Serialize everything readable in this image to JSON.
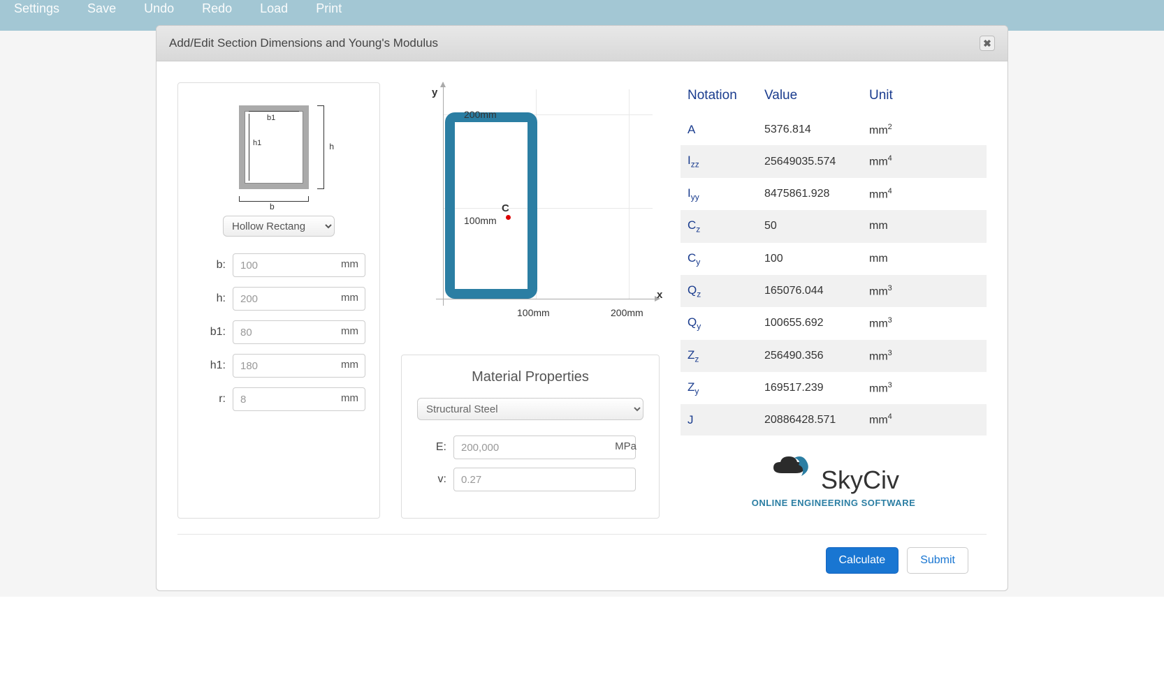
{
  "menu": {
    "settings": "Settings",
    "save": "Save",
    "undo": "Undo",
    "redo": "Redo",
    "load": "Load",
    "print": "Print"
  },
  "dialog": {
    "title": "Add/Edit Section Dimensions and Young's Modulus"
  },
  "shape_select": "Hollow Rectang",
  "diagram": {
    "b": "b",
    "h": "h",
    "b1": "b1",
    "h1": "h1"
  },
  "dims": {
    "b": {
      "label": "b:",
      "value": "100",
      "unit": "mm"
    },
    "h": {
      "label": "h:",
      "value": "200",
      "unit": "mm"
    },
    "b1": {
      "label": "b1:",
      "value": "80",
      "unit": "mm"
    },
    "h1": {
      "label": "h1:",
      "value": "180",
      "unit": "mm"
    },
    "r": {
      "label": "r:",
      "value": "8",
      "unit": "mm"
    }
  },
  "graph": {
    "ylabel": "y",
    "xlabel": "x",
    "centroid": "C",
    "x_tick_1": "100mm",
    "x_tick_2": "200mm",
    "y_tick_1": "100mm",
    "y_tick_2": "200mm"
  },
  "material": {
    "title": "Material Properties",
    "selected": "Structural Steel",
    "E": {
      "label": "E:",
      "value": "200,000",
      "unit": "MPa"
    },
    "v": {
      "label": "v:",
      "value": "0.27",
      "unit": ""
    }
  },
  "props": {
    "head_notation": "Notation",
    "head_value": "Value",
    "head_unit": "Unit",
    "rows": [
      {
        "sym": "A",
        "sub": "",
        "value": "5376.814",
        "unit": "mm",
        "exp": "2"
      },
      {
        "sym": "I",
        "sub": "zz",
        "value": "25649035.574",
        "unit": "mm",
        "exp": "4"
      },
      {
        "sym": "I",
        "sub": "yy",
        "value": "8475861.928",
        "unit": "mm",
        "exp": "4"
      },
      {
        "sym": "C",
        "sub": "z",
        "value": "50",
        "unit": "mm",
        "exp": ""
      },
      {
        "sym": "C",
        "sub": "y",
        "value": "100",
        "unit": "mm",
        "exp": ""
      },
      {
        "sym": "Q",
        "sub": "z",
        "value": "165076.044",
        "unit": "mm",
        "exp": "3"
      },
      {
        "sym": "Q",
        "sub": "y",
        "value": "100655.692",
        "unit": "mm",
        "exp": "3"
      },
      {
        "sym": "Z",
        "sub": "z",
        "value": "256490.356",
        "unit": "mm",
        "exp": "3"
      },
      {
        "sym": "Z",
        "sub": "y",
        "value": "169517.239",
        "unit": "mm",
        "exp": "3"
      },
      {
        "sym": "J",
        "sub": "",
        "value": "20886428.571",
        "unit": "mm",
        "exp": "4"
      }
    ]
  },
  "logo": {
    "name": "SkyCiv",
    "tagline": "ONLINE ENGINEERING SOFTWARE"
  },
  "buttons": {
    "calculate": "Calculate",
    "submit": "Submit"
  }
}
